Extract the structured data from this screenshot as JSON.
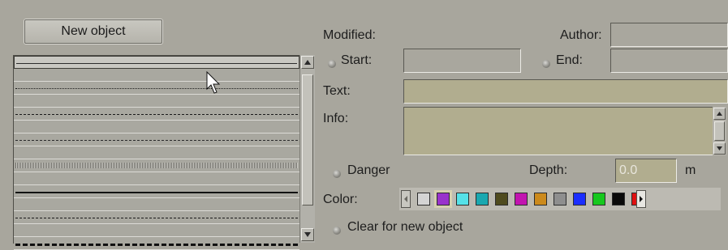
{
  "toolbar": {
    "new_object_label": "New object"
  },
  "labels": {
    "modified": "Modified:",
    "author": "Author:",
    "start": "Start:",
    "end": "End:",
    "text": "Text:",
    "info": "Info:",
    "danger": "Danger",
    "depth": "Depth:",
    "depth_unit": "m",
    "color": "Color:",
    "clear_for_new_object": "Clear for new object"
  },
  "fields": {
    "author": "",
    "start": "",
    "end": "",
    "text": "",
    "info": "",
    "depth": "0.0"
  },
  "line_styles": [
    "solid-thin",
    "blank",
    "dotted",
    "blank",
    "dash-dot",
    "blank",
    "short-dash",
    "blank",
    "hatched-band",
    "blank",
    "solid-thick",
    "blank",
    "long-dash",
    "blank-light",
    "dash-heavy"
  ],
  "colors": {
    "palette": [
      "#d4d4d4",
      "#9933cc",
      "#55e1e8",
      "#1aa8b0",
      "#4f4b1e",
      "#c214b0",
      "#cc8a1c",
      "#8e8e8e",
      "#1a2dff",
      "#16c81e",
      "#0a0a0a",
      "#e01010"
    ],
    "selected_index": 1
  },
  "icons": {
    "scroll_up": "triangle-up-icon",
    "scroll_down": "triangle-down-icon",
    "palette_left": "triangle-left-icon",
    "palette_right": "triangle-right-icon",
    "cursor": "mouse-pointer-icon"
  }
}
